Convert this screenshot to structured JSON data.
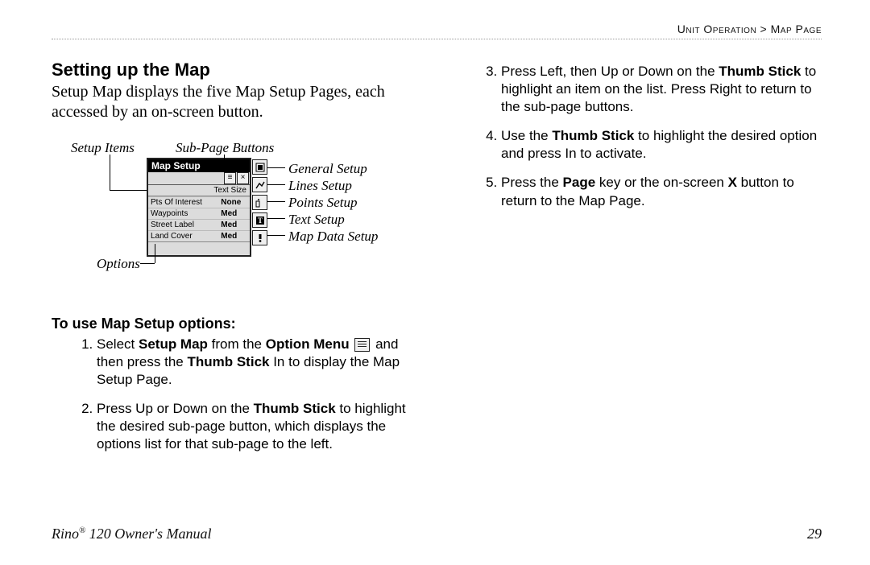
{
  "breadcrumb": {
    "section": "Unit Operation",
    "sep": " > ",
    "page": "Map Page"
  },
  "h2": "Setting up the Map",
  "intro": "Setup Map displays the five Map Setup Pages, each accessed by an on-screen button.",
  "fig": {
    "setup_items": "Setup Items",
    "sub_page_buttons": "Sub-Page Buttons",
    "options": "Options",
    "callouts": [
      "General Setup",
      "Lines Setup",
      "Points Setup",
      "Text Setup",
      "Map Data Setup"
    ],
    "device": {
      "title": "Map Setup",
      "subheader": "Text Size",
      "rows": [
        {
          "k": "Pts Of Interest",
          "v": "None"
        },
        {
          "k": "Waypoints",
          "v": "Med"
        },
        {
          "k": "Street Label",
          "v": "Med"
        },
        {
          "k": "Land Cover",
          "v": "Med"
        }
      ]
    }
  },
  "h3": "To use Map Setup options:",
  "steps_left": [
    {
      "pre": "Select ",
      "b1": "Setup Map",
      "mid": " from the ",
      "b2": "Option Menu",
      "post_icon": " and then press the ",
      "b3": "Thumb Stick",
      "tail": " In to display the Map Setup Page."
    },
    {
      "pre": "Press Up or Down on the ",
      "b1": "Thumb Stick",
      "tail": " to highlight the desired sub-page button, which displays the options list for that sub-page to the left."
    }
  ],
  "steps_right": [
    {
      "pre": "Press Left, then Up or Down on the ",
      "b1": "Thumb Stick",
      "tail": " to highlight an item on the list. Press Right to return to the sub-page buttons."
    },
    {
      "pre": "Use the ",
      "b1": "Thumb Stick",
      "tail": " to highlight the desired option and press In to activate."
    },
    {
      "pre": "Press the ",
      "b1": "Page",
      "mid": " key or the on-screen ",
      "b2": "X",
      "tail": " button to return to the Map Page."
    }
  ],
  "footer": {
    "manual": "Rino® 120 Owner's Manual",
    "page": "29"
  }
}
